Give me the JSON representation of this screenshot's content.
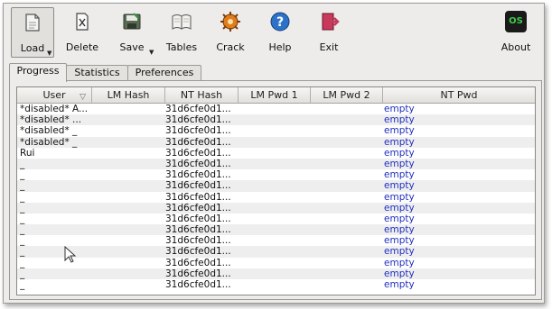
{
  "toolbar": {
    "buttons": [
      {
        "id": "load",
        "label": "Load",
        "icon": "folder-open-icon",
        "has_dropdown": true
      },
      {
        "id": "delete",
        "label": "Delete",
        "icon": "delete-icon"
      },
      {
        "id": "save",
        "label": "Save",
        "icon": "save-icon",
        "has_dropdown": true
      },
      {
        "id": "tables",
        "label": "Tables",
        "icon": "tables-icon"
      },
      {
        "id": "crack",
        "label": "Crack",
        "icon": "crack-icon"
      },
      {
        "id": "help",
        "label": "Help",
        "icon": "help-icon"
      },
      {
        "id": "exit",
        "label": "Exit",
        "icon": "exit-icon"
      },
      {
        "id": "about",
        "label": "About",
        "icon": "os-logo-icon",
        "badge": "OS"
      }
    ]
  },
  "tabs": [
    {
      "label": "Progress",
      "active": true
    },
    {
      "label": "Statistics",
      "active": false
    },
    {
      "label": "Preferences",
      "active": false
    }
  ],
  "table": {
    "columns": [
      "User",
      "LM Hash",
      "NT Hash",
      "LM Pwd 1",
      "LM Pwd 2",
      "NT Pwd"
    ],
    "rows": [
      {
        "user": "*disabled* A...",
        "lm_hash": "",
        "nt_hash": "31d6cfe0d1...",
        "lm_pwd1": "",
        "lm_pwd2": "",
        "nt_pwd": "empty"
      },
      {
        "user": "*disabled* ...",
        "lm_hash": "",
        "nt_hash": "31d6cfe0d1...",
        "lm_pwd1": "",
        "lm_pwd2": "",
        "nt_pwd": "empty"
      },
      {
        "user": "*disabled* _",
        "lm_hash": "",
        "nt_hash": "31d6cfe0d1...",
        "lm_pwd1": "",
        "lm_pwd2": "",
        "nt_pwd": "empty"
      },
      {
        "user": "*disabled* _",
        "lm_hash": "",
        "nt_hash": "31d6cfe0d1...",
        "lm_pwd1": "",
        "lm_pwd2": "",
        "nt_pwd": "empty"
      },
      {
        "user": "Rui",
        "lm_hash": "",
        "nt_hash": "31d6cfe0d1...",
        "lm_pwd1": "",
        "lm_pwd2": "",
        "nt_pwd": "empty"
      },
      {
        "user": "_",
        "lm_hash": "",
        "nt_hash": "31d6cfe0d1...",
        "lm_pwd1": "",
        "lm_pwd2": "",
        "nt_pwd": "empty"
      },
      {
        "user": "_",
        "lm_hash": "",
        "nt_hash": "31d6cfe0d1...",
        "lm_pwd1": "",
        "lm_pwd2": "",
        "nt_pwd": "empty"
      },
      {
        "user": "_",
        "lm_hash": "",
        "nt_hash": "31d6cfe0d1...",
        "lm_pwd1": "",
        "lm_pwd2": "",
        "nt_pwd": "empty"
      },
      {
        "user": "_",
        "lm_hash": "",
        "nt_hash": "31d6cfe0d1...",
        "lm_pwd1": "",
        "lm_pwd2": "",
        "nt_pwd": "empty"
      },
      {
        "user": "_",
        "lm_hash": "",
        "nt_hash": "31d6cfe0d1...",
        "lm_pwd1": "",
        "lm_pwd2": "",
        "nt_pwd": "empty"
      },
      {
        "user": "_",
        "lm_hash": "",
        "nt_hash": "31d6cfe0d1...",
        "lm_pwd1": "",
        "lm_pwd2": "",
        "nt_pwd": "empty"
      },
      {
        "user": "_",
        "lm_hash": "",
        "nt_hash": "31d6cfe0d1...",
        "lm_pwd1": "",
        "lm_pwd2": "",
        "nt_pwd": "empty"
      },
      {
        "user": "_",
        "lm_hash": "",
        "nt_hash": "31d6cfe0d1...",
        "lm_pwd1": "",
        "lm_pwd2": "",
        "nt_pwd": "empty"
      },
      {
        "user": "_",
        "lm_hash": "",
        "nt_hash": "31d6cfe0d1...",
        "lm_pwd1": "",
        "lm_pwd2": "",
        "nt_pwd": "empty"
      },
      {
        "user": "_",
        "lm_hash": "",
        "nt_hash": "31d6cfe0d1...",
        "lm_pwd1": "",
        "lm_pwd2": "",
        "nt_pwd": "empty"
      },
      {
        "user": "_",
        "lm_hash": "",
        "nt_hash": "31d6cfe0d1...",
        "lm_pwd1": "",
        "lm_pwd2": "",
        "nt_pwd": "empty"
      },
      {
        "user": "_",
        "lm_hash": "",
        "nt_hash": "31d6cfe0d1...",
        "lm_pwd1": "",
        "lm_pwd2": "",
        "nt_pwd": "empty"
      }
    ]
  },
  "colors": {
    "nt_pwd_text": "#1f2fbf",
    "window_bg": "#edeceb"
  }
}
